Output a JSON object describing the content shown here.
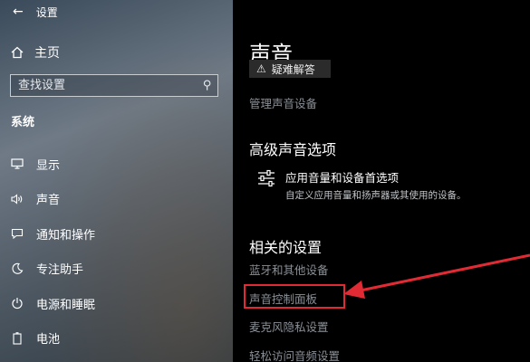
{
  "window": {
    "title": "设置"
  },
  "sidebar": {
    "home_label": "主页",
    "search_placeholder": "查找设置",
    "section_label": "系统",
    "items": [
      {
        "label": "显示",
        "icon": "monitor-icon"
      },
      {
        "label": "声音",
        "icon": "speaker-icon"
      },
      {
        "label": "通知和操作",
        "icon": "notification-icon"
      },
      {
        "label": "专注助手",
        "icon": "moon-icon"
      },
      {
        "label": "电源和睡眠",
        "icon": "power-icon"
      },
      {
        "label": "电池",
        "icon": "battery-icon"
      }
    ]
  },
  "main": {
    "title": "声音",
    "troubleshoot_label": "疑难解答",
    "manage_devices_link": "管理声音设备",
    "advanced_title": "高级声音选项",
    "advanced_item": {
      "title": "应用音量和设备首选项",
      "description": "自定义应用音量和扬声器或其使用的设备。",
      "icon": "sliders-icon"
    },
    "related_title": "相关的设置",
    "related_links": [
      "蓝牙和其他设备",
      "声音控制面板",
      "麦克风隐私设置",
      "轻松访问音频设置"
    ]
  },
  "colors": {
    "highlight": "#e12b34",
    "link": "#8a8f96"
  }
}
